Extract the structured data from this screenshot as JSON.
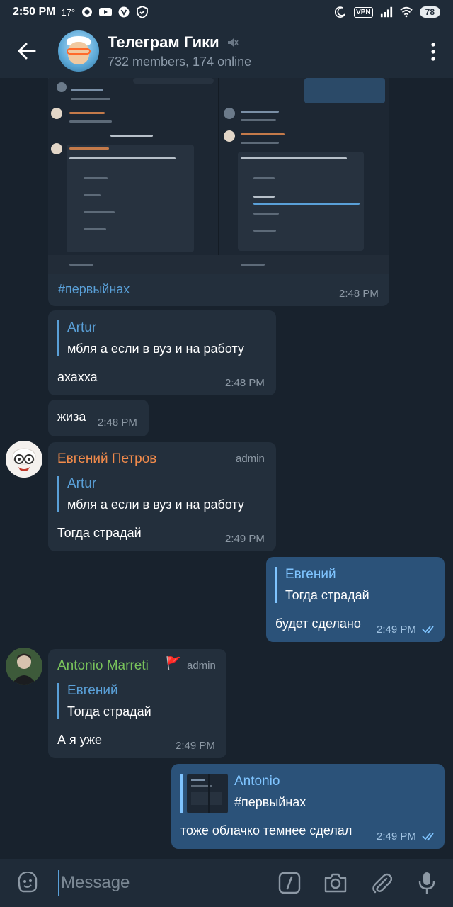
{
  "status_bar": {
    "time": "2:50 PM",
    "temperature": "17°",
    "vpn": "VPN",
    "battery": "78"
  },
  "header": {
    "title": "Телеграм Гики",
    "subtitle": "732 members, 174 online"
  },
  "colors": {
    "accent": "#5aa0d8",
    "incoming_bubble": "#232f3c",
    "outgoing_bubble": "#2b5279",
    "name_evgeniy": "#f28b4b",
    "name_antonio": "#79c35b",
    "read_check": "#7fc4ff"
  },
  "messages": [
    {
      "type": "photo",
      "caption": "#первыйнах",
      "time": "2:48 PM"
    },
    {
      "reply_name": "Artur",
      "reply_text": "мбля а если в вуз и на работу",
      "text": "ахахха",
      "time": "2:48 PM"
    },
    {
      "text": "жиза",
      "time": "2:48 PM"
    },
    {
      "sender": "Евгений Петров",
      "role": "admin",
      "reply_name": "Artur",
      "reply_text": "мбля а если в вуз и на работу",
      "text": "Тогда страдай",
      "time": "2:49 PM"
    },
    {
      "reply_name": "Евгений",
      "reply_text": "Тогда страдай",
      "text": "будет сделано",
      "time": "2:49 PM"
    },
    {
      "sender": "Antonio Marreti",
      "badge": "🚩",
      "role": "admin",
      "reply_name": "Евгений",
      "reply_text": "Тогда страдай",
      "text": "А я уже",
      "time": "2:49 PM"
    },
    {
      "reply_name": "Antonio",
      "reply_text": "#первыйнах",
      "text": "тоже облачко темнее сделал",
      "time": "2:49 PM"
    }
  ],
  "input": {
    "placeholder": "Message"
  },
  "icons": [
    "back-arrow-icon",
    "mute-icon",
    "more-vertical-icon",
    "sticker-icon",
    "bot-command-icon",
    "camera-icon",
    "attach-icon",
    "microphone-icon"
  ]
}
